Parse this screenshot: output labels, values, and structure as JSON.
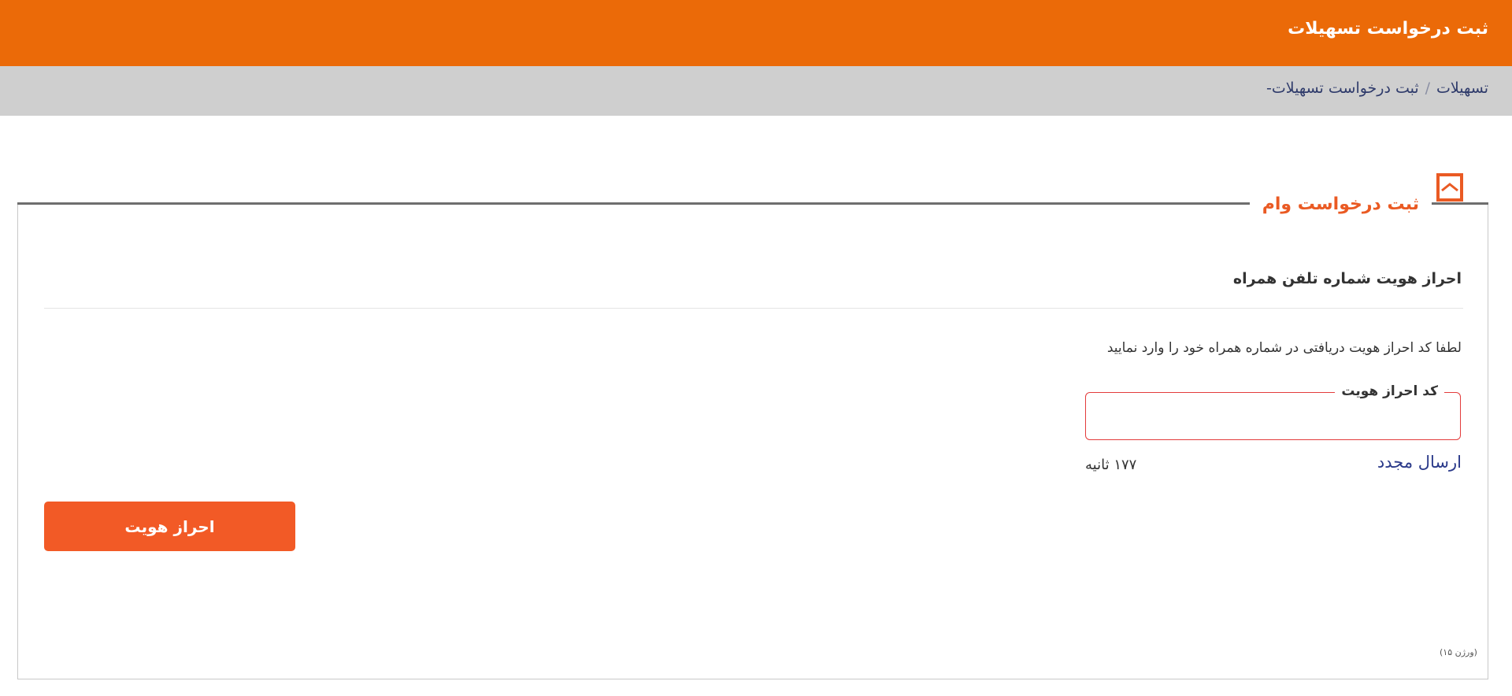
{
  "header": {
    "title": "ثبت درخواست تسهیلات"
  },
  "breadcrumb": {
    "root": "تسهیلات",
    "separator": "/",
    "current": "ثبت درخواست تسهیلات-"
  },
  "panel": {
    "title": "ثبت درخواست وام",
    "icon": "collapse-icon"
  },
  "verification": {
    "heading": "احراز هویت شماره تلفن همراه",
    "instruction": "لطفا کد احراز هویت دریافتی در شماره همراه خود را وارد نمایید",
    "code_label": "کد احراز هویت",
    "code_value": "",
    "resend_label": "ارسال مجدد",
    "timer_text": "۱۷۷ ثانیه",
    "submit_label": "احراز هویت"
  },
  "footer": {
    "version": "(ورژن ۱۵)"
  },
  "colors": {
    "header_bg": "#eb6a08",
    "breadcrumb_bg": "#cfcfcf",
    "accent": "#ea5a23",
    "button_bg": "#f25a26",
    "field_border_error": "#e33b3b",
    "link": "#2b3a8a"
  }
}
